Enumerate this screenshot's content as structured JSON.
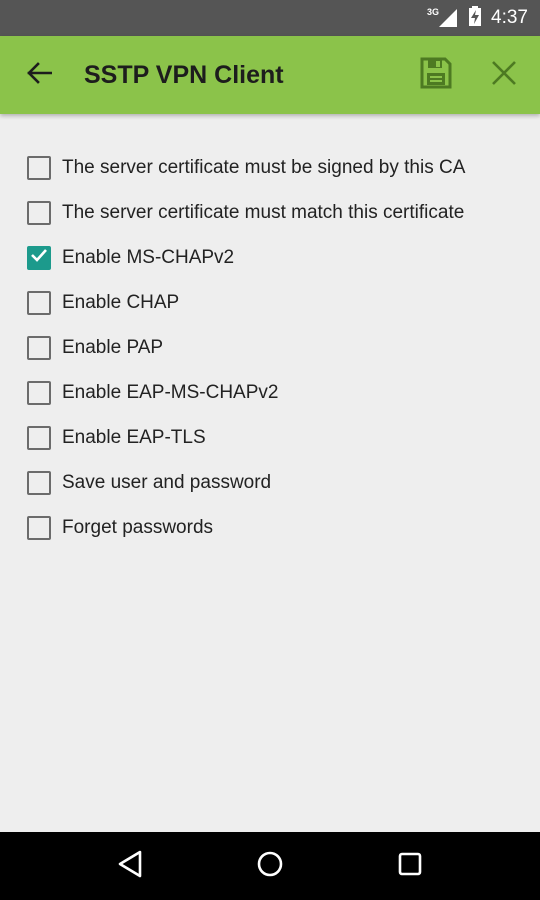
{
  "status_bar": {
    "network": "3G",
    "time": "4:37"
  },
  "app_bar": {
    "title": "SSTP VPN Client",
    "back_icon": "arrow-left-icon",
    "save_icon": "save-icon",
    "close_icon": "close-icon",
    "color": "#8bc34a"
  },
  "options": [
    {
      "label": "The server certificate must be signed by this CA",
      "checked": false
    },
    {
      "label": "The server certificate must match this certificate",
      "checked": false
    },
    {
      "label": "Enable MS-CHAPv2",
      "checked": true
    },
    {
      "label": "Enable CHAP",
      "checked": false
    },
    {
      "label": "Enable PAP",
      "checked": false
    },
    {
      "label": "Enable EAP-MS-CHAPv2",
      "checked": false
    },
    {
      "label": "Enable EAP-TLS",
      "checked": false
    },
    {
      "label": "Save user and password",
      "checked": false
    },
    {
      "label": "Forget passwords",
      "checked": false
    }
  ],
  "accent_color": "#1c9a8c",
  "nav_bar": {
    "back_icon": "triangle-back-icon",
    "home_icon": "circle-home-icon",
    "recents_icon": "square-recents-icon"
  }
}
